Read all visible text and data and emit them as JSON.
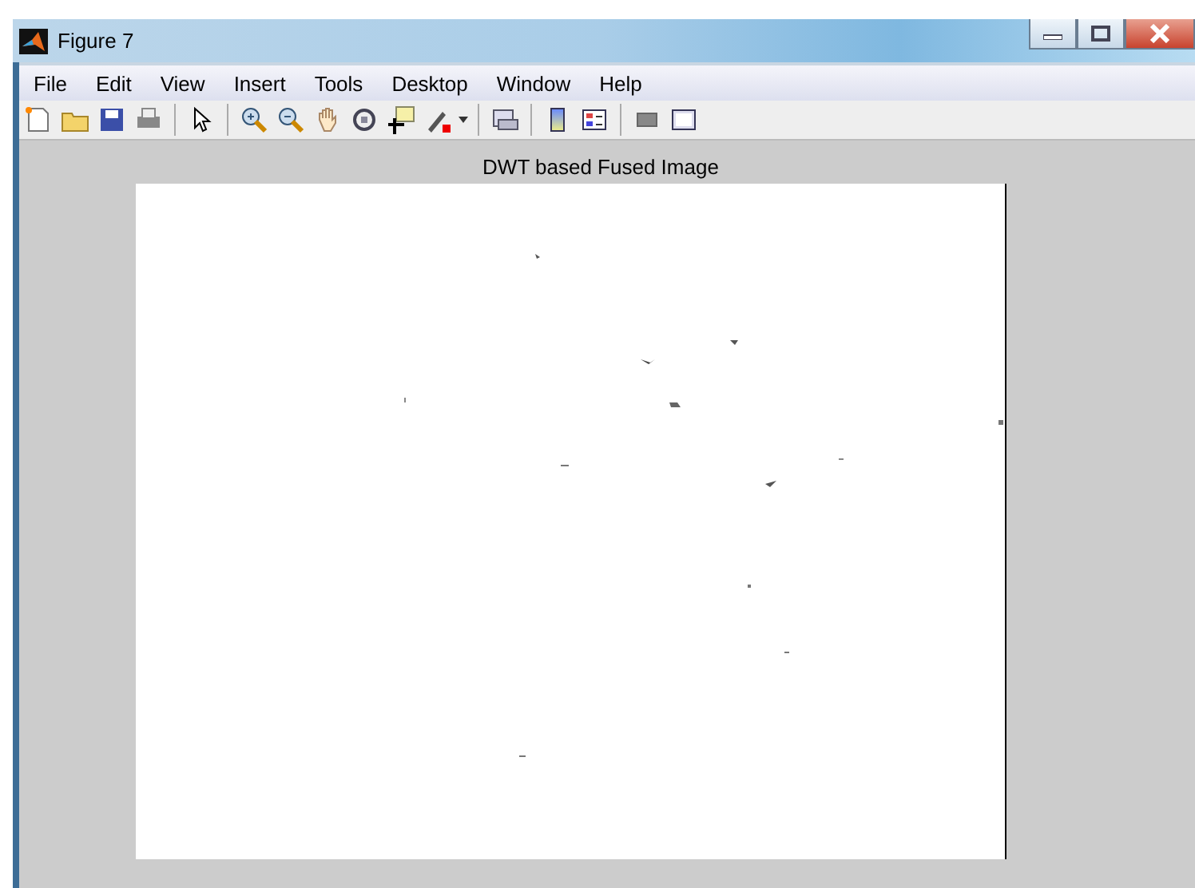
{
  "window": {
    "title": "Figure 7"
  },
  "menu": [
    "File",
    "Edit",
    "View",
    "Insert",
    "Tools",
    "Desktop",
    "Window",
    "Help"
  ],
  "axes": {
    "title": "DWT based Fused Image"
  }
}
